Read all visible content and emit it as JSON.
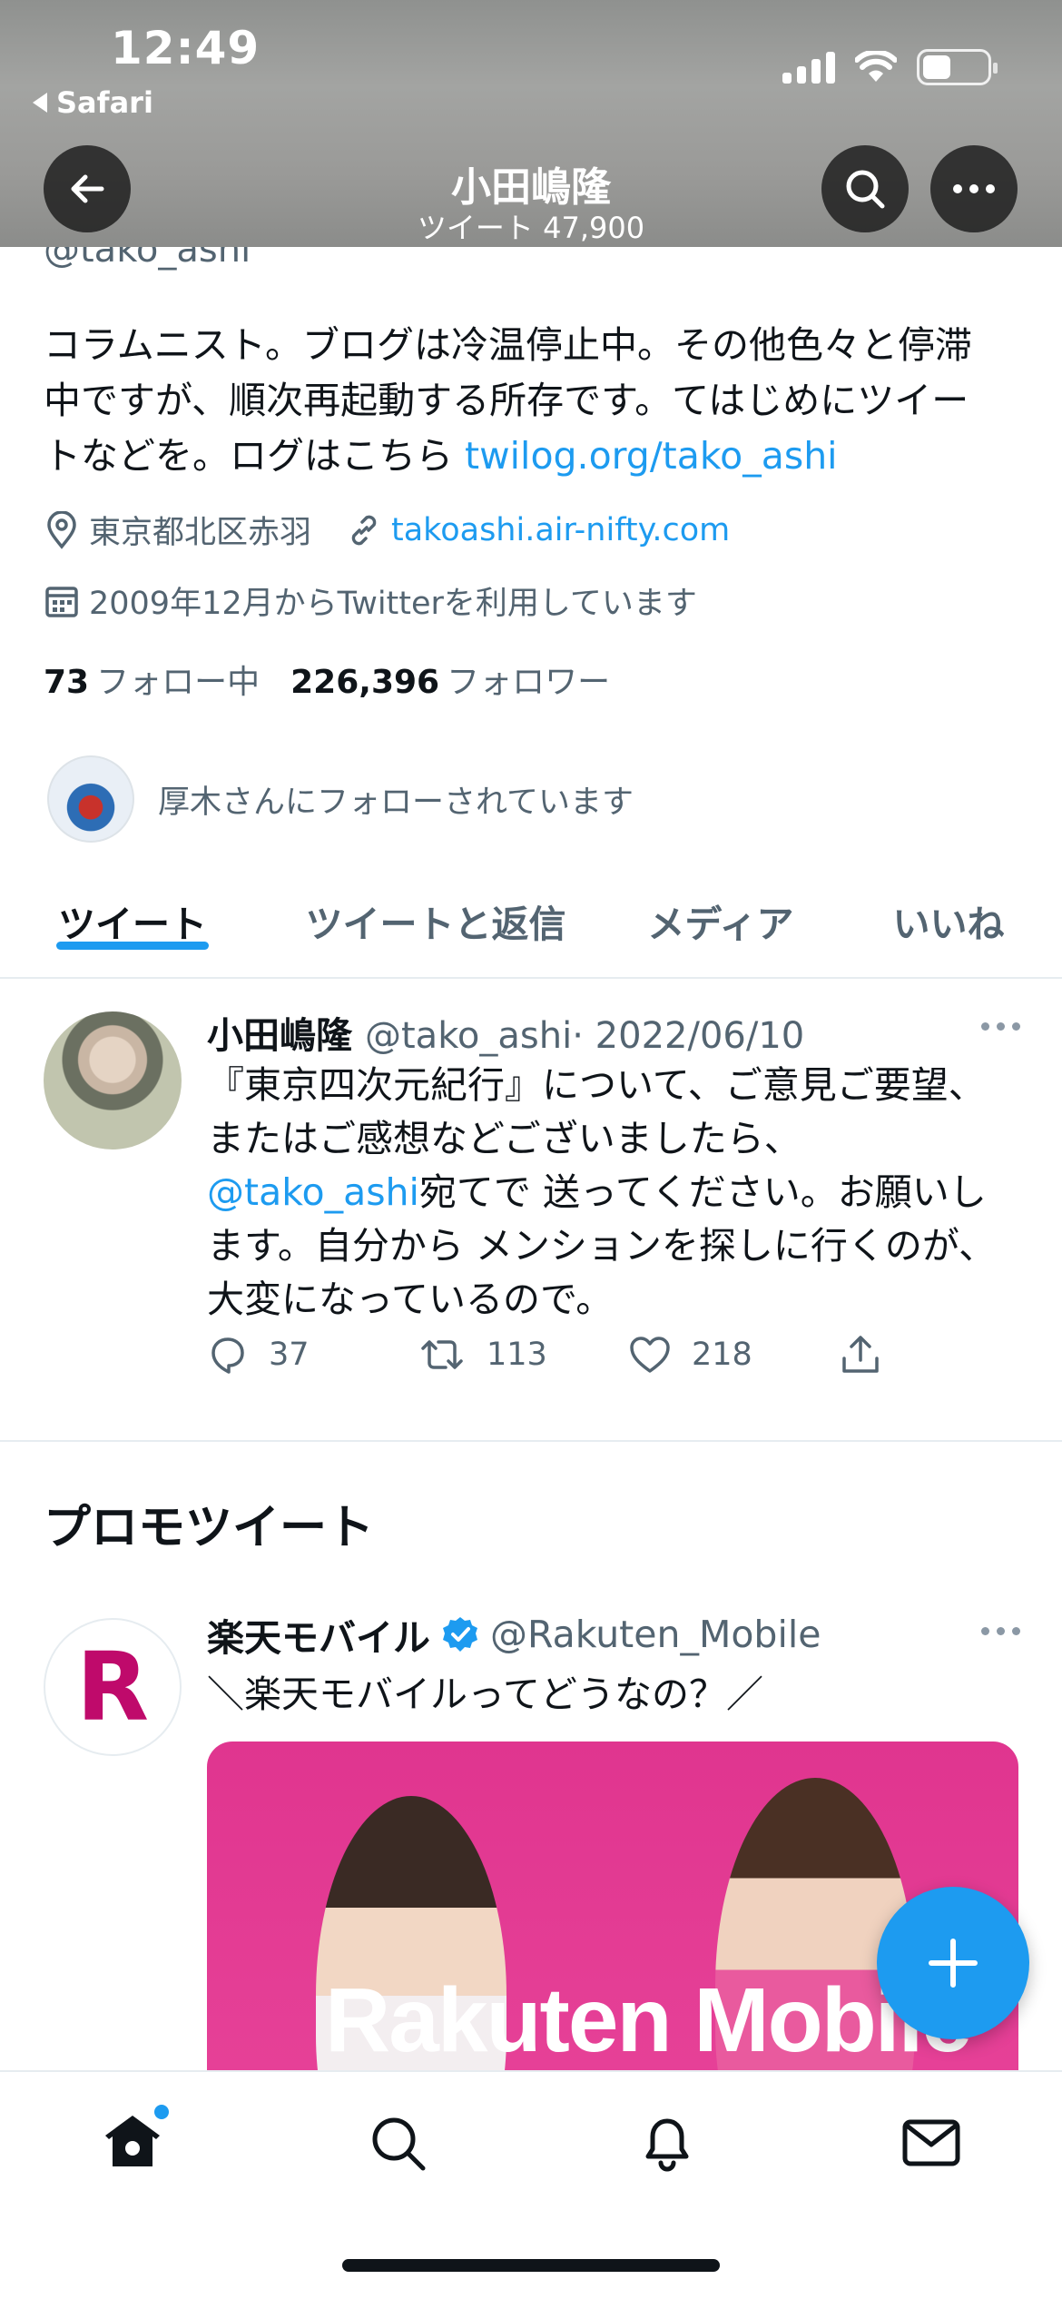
{
  "status_bar": {
    "time": "12:49",
    "back_app": "Safari"
  },
  "header": {
    "name": "小田嶋隆",
    "tweet_count": "ツイート 47,900"
  },
  "profile": {
    "handle": "@tako_ashi",
    "bio_line1": "コラムニスト。ブログは冷温停止中。その他色々と停滞",
    "bio_line2": "中ですが、順次再起動する所存です。てはじめにツイー",
    "bio_line3": "トなどを。ログはこちら ",
    "bio_link": "twilog.org/tako_ashi",
    "location": "東京都北区赤羽",
    "website": "takoashi.air-nifty.com",
    "joined": "2009年12月からTwitterを利用しています",
    "following_count": "73",
    "following_label": "フォロー中",
    "followers_count": "226,396",
    "followers_label": "フォロワー",
    "followed_by": "厚木さんにフォローされています"
  },
  "tabs": [
    {
      "label": "ツイート",
      "active": true
    },
    {
      "label": "ツイートと返信",
      "active": false
    },
    {
      "label": "メディア",
      "active": false
    },
    {
      "label": "いいね",
      "active": false
    }
  ],
  "tweet": {
    "name": "小田嶋隆",
    "handle": "@tako_ashi",
    "date": "· 2022/06/10",
    "line1": "『東京四次元紀行』について、ご意見ご要望、",
    "line2": "またはご感想などございましたら、",
    "mention": "@tako_ashi",
    "line3_rest": "宛てで 送ってください。お願いし",
    "line4": "ます。自分から メンションを探しに行くのが、",
    "line5": "大変になっているので。",
    "replies": "37",
    "retweets": "113",
    "likes": "218"
  },
  "promo": {
    "section_title": "プロモツイート",
    "name": "楽天モバイル",
    "handle": "@Rakuten_Mobile",
    "text": "＼楽天モバイルってどうなの？／",
    "avatar_letter": "R",
    "image_brand": "Rakuten Mobile"
  },
  "colors": {
    "accent": "#1d9bf0",
    "text": "#0f1419",
    "muted": "#536471",
    "brand_pink": "#e0358f"
  },
  "icons": [
    "back-arrow-icon",
    "search-icon",
    "more-icon",
    "location-icon",
    "link-icon",
    "calendar-icon",
    "reply-icon",
    "retweet-icon",
    "like-icon",
    "share-icon",
    "verified-icon",
    "compose-icon",
    "home-icon",
    "notifications-icon",
    "messages-icon"
  ]
}
